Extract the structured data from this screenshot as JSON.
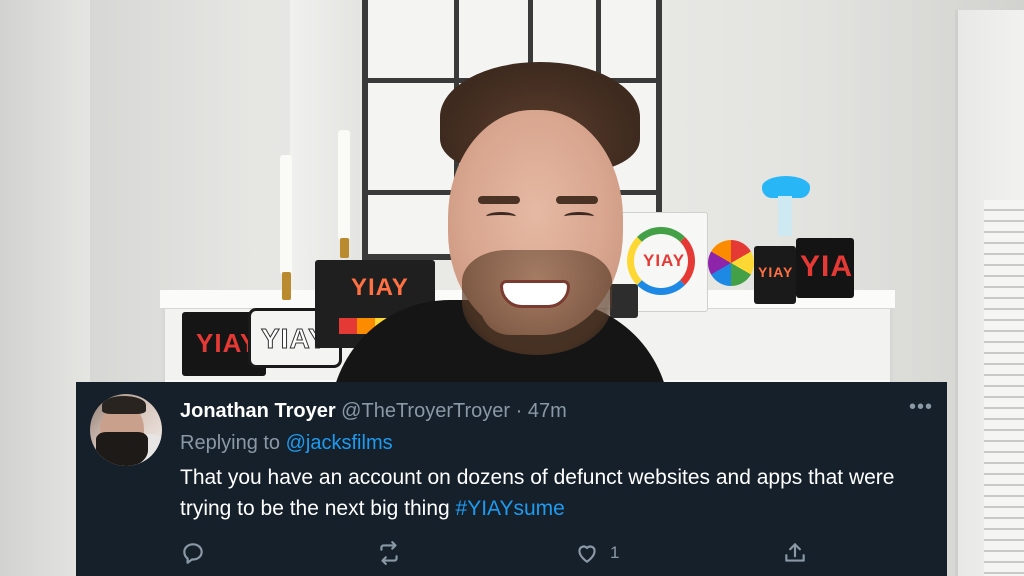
{
  "tweet": {
    "author_name": "Jonathan Troyer",
    "author_handle": "@TheTroyerTroyer",
    "separator": "·",
    "time_ago": "47m",
    "more_label": "•••",
    "replying_prefix": "Replying to",
    "replying_to": "@jacksfilms",
    "text": "That you have an account on dozens of defunct websites and apps that were trying to be the next big thing",
    "hashtag": "#YIAYsume",
    "like_count": "1"
  },
  "backdrop": {
    "box_labels": [
      "YIAY",
      "YIAY",
      "YIAY",
      "YIAY",
      "YIAY",
      "YIA"
    ]
  },
  "colors": {
    "tweet_background": "#15202b",
    "muted_text": "#8b98a5",
    "link": "#1d9bf0"
  },
  "icons": [
    "reply-icon",
    "retweet-icon",
    "like-icon",
    "share-icon",
    "more-icon"
  ]
}
